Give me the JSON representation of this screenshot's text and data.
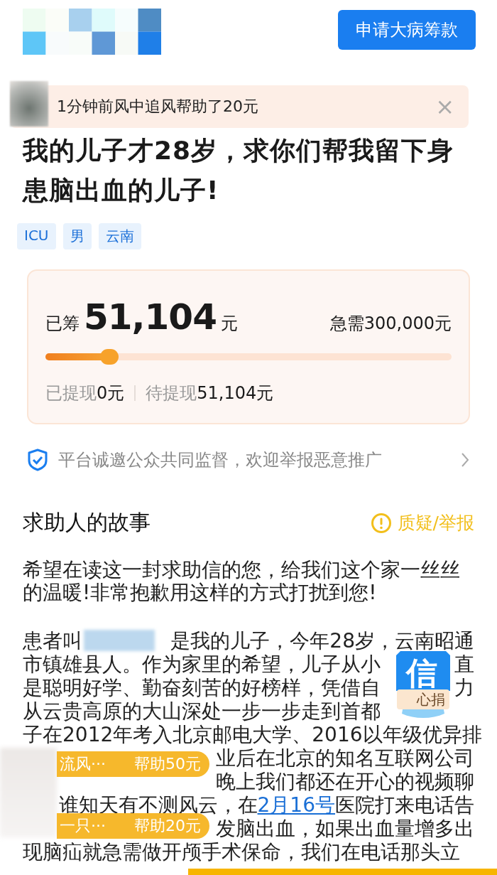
{
  "header": {
    "apply_button": "申请大病筹款"
  },
  "toast": {
    "text": "1分钟前风中追风帮助了20元",
    "close": "×"
  },
  "title": "我的儿子才28岁，求你们帮我留下身患脑出血的儿子!",
  "tags": [
    "ICU",
    "男",
    "云南"
  ],
  "funding": {
    "raised_label": "已筹",
    "raised_amount": "51,104",
    "raised_unit": "元",
    "target": "急需300,000元",
    "level": 0.17,
    "withdrawn": {
      "label": "已提现",
      "value": "0元"
    },
    "pending": {
      "label": "待提现",
      "value": "51,104元"
    }
  },
  "notice": {
    "text": "平台诚邀公众共同监督，欢迎举报恶意推广"
  },
  "story": {
    "heading": "求助人的故事",
    "report": "质疑/举报",
    "intro": "希望在读这一封求助信的您，给我们这个家一丝丝的温暖!非常抱歉用这样的方式打扰到您!",
    "lines": [
      {
        "left": [
          {
            "kind": "text",
            "text": "患者叫"
          },
          {
            "kind": "redacted"
          }
        ],
        "right": [
          {
            "kind": "text",
            "text": "是我的儿子，今年28岁，云南昭通"
          }
        ]
      },
      {
        "left": [
          {
            "kind": "text",
            "text": "市镇雄县人。作为家里的希望，儿子从小"
          }
        ],
        "right": [
          {
            "kind": "text",
            "text": "直"
          }
        ]
      },
      {
        "left": [
          {
            "kind": "text",
            "text": "是聪明好学、勤奋刻苦的好榜样，凭借自"
          }
        ],
        "right": [
          {
            "kind": "text",
            "text": "力"
          }
        ]
      },
      {
        "left": [
          {
            "kind": "text",
            "text": "从云贵高原的大山深处一步一步走到首都"
          }
        ]
      },
      {
        "left": [
          {
            "kind": "text",
            "text": "子在2012年考入北京邮电大学、2016以年级优异排"
          }
        ]
      },
      {
        "right": [
          {
            "kind": "text",
            "text": "业后在北京的知名互联网公司"
          }
        ]
      },
      {
        "right": [
          {
            "kind": "text",
            "text": "晚上我们都还在开心的视频聊"
          }
        ]
      },
      {
        "right": [
          {
            "kind": "text",
            "text": "谁知天有不测风云，在"
          },
          {
            "kind": "link",
            "text": "2月16号"
          },
          {
            "kind": "text",
            "text": "医院打来电话告"
          }
        ]
      },
      {
        "right": [
          {
            "kind": "text",
            "text": "发脑出血，如果出血量增多出"
          }
        ]
      },
      {
        "left": [
          {
            "kind": "text",
            "text": "现脑疝就急需做开颅手术保命，我们在电话那头立"
          }
        ]
      }
    ]
  },
  "badge": {
    "glyph": "信",
    "label": "心捐"
  },
  "donations": [
    {
      "name": "流风···",
      "amount": "帮助50元"
    },
    {
      "name": "一只···",
      "amount": "帮助20元"
    }
  ]
}
